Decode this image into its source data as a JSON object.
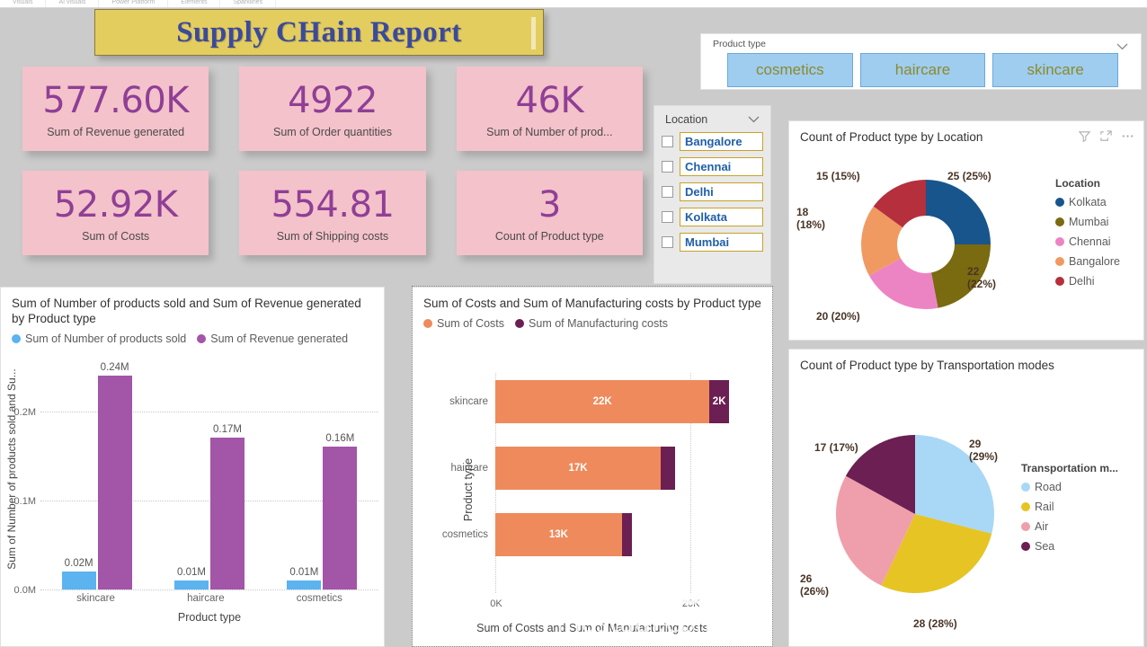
{
  "ribbon": {
    "tabs": [
      "Visuals",
      "AI visuals",
      "Power Platform",
      "Elements",
      "Sparklines"
    ]
  },
  "header": {
    "title": "Supply CHain Report",
    "banner_bg": "#e3cd5f",
    "title_color": "#3b4a9c"
  },
  "kpis": [
    {
      "value": "577.60K",
      "label": "Sum of Revenue generated"
    },
    {
      "value": "4922",
      "label": "Sum of Order quantities"
    },
    {
      "value": "46K",
      "label": "Sum of Number of prod..."
    },
    {
      "value": "52.92K",
      "label": "Sum of Costs"
    },
    {
      "value": "554.81",
      "label": "Sum of Shipping costs"
    },
    {
      "value": "3",
      "label": "Count of Product type"
    }
  ],
  "kpi_style": {
    "card_bg": "#f4c2ca",
    "value_color": "#8f3f96"
  },
  "product_type_slicer": {
    "title": "Product type",
    "caret": "chevron-down-icon",
    "options": [
      "cosmetics",
      "haircare",
      "skincare"
    ],
    "selected": [],
    "button_bg": "#9fcdf0",
    "button_text_color": "#8c8a2a"
  },
  "location_slicer": {
    "title": "Location",
    "caret": "chevron-down-icon",
    "items": [
      {
        "label": "Bangalore",
        "checked": false
      },
      {
        "label": "Chennai",
        "checked": false
      },
      {
        "label": "Delhi",
        "checked": false
      },
      {
        "label": "Kolkata",
        "checked": false
      },
      {
        "label": "Mumbai",
        "checked": false
      }
    ],
    "pill_border": "#c9a227",
    "pill_text_color": "#1f5fa8"
  },
  "visual_header_icons": [
    "filter-icon",
    "focus-mode-icon",
    "more-options-icon"
  ],
  "watermark": {
    "arabic": "مستقل",
    "latin": "mostaql.com"
  },
  "chart_data": [
    {
      "id": "column_chart",
      "type": "bar",
      "title": "Sum of Number of products sold and Sum of Revenue generated by Product type",
      "xlabel": "Product type",
      "ylabel": "Sum of Number of products sold and Su...",
      "categories": [
        "skincare",
        "haircare",
        "cosmetics"
      ],
      "ylim": [
        0,
        0.26
      ],
      "yticks": [
        "0.0M",
        "0.1M",
        "0.2M"
      ],
      "ytick_values": [
        0.0,
        0.1,
        0.2
      ],
      "grid": true,
      "legend_position": "top",
      "series": [
        {
          "name": "Sum of Number of products sold",
          "color": "#5bb3ef",
          "values": [
            0.02,
            0.01,
            0.01
          ],
          "labels": [
            "0.02M",
            "0.01M",
            "0.01M"
          ]
        },
        {
          "name": "Sum of Revenue generated",
          "color": "#a355a8",
          "values": [
            0.24,
            0.17,
            0.16
          ],
          "labels": [
            "0.24M",
            "0.17M",
            "0.16M"
          ]
        }
      ]
    },
    {
      "id": "stacked_bar_chart",
      "type": "bar",
      "orientation": "horizontal",
      "stacked": true,
      "title": "Sum of Costs and Sum of Manufacturing costs by Product type",
      "xlabel": "Sum of Costs and Sum of Manufacturing costs",
      "ylabel": "Product type",
      "categories": [
        "skincare",
        "haircare",
        "cosmetics"
      ],
      "xlim": [
        0,
        24
      ],
      "xticks": [
        "0K",
        "20K"
      ],
      "xtick_values": [
        0,
        20
      ],
      "grid": true,
      "legend_position": "top",
      "series": [
        {
          "name": "Sum of Costs",
          "color": "#ef8a5c",
          "values": [
            22,
            17,
            13
          ],
          "labels": [
            "22K",
            "17K",
            "13K"
          ]
        },
        {
          "name": "Sum of Manufacturing costs",
          "color": "#6b1f52",
          "values": [
            2,
            1.5,
            1
          ],
          "labels": [
            "2K",
            "",
            ""
          ]
        }
      ]
    },
    {
      "id": "donut_location",
      "type": "pie",
      "donut": true,
      "title": "Count of Product type by Location",
      "legend_title": "Location",
      "legend_position": "right",
      "categories": [
        "Kolkata",
        "Mumbai",
        "Chennai",
        "Bangalore",
        "Delhi"
      ],
      "values": [
        25,
        22,
        20,
        18,
        15
      ],
      "percents": [
        "25%",
        "22%",
        "20%",
        "18%",
        "15%"
      ],
      "labels": [
        "25 (25%)",
        "22\n(22%)",
        "20 (20%)",
        "18\n(18%)",
        "15 (15%)"
      ],
      "colors": [
        "#17558c",
        "#7a6a10",
        "#ec84c4",
        "#f09a62",
        "#b5303c"
      ]
    },
    {
      "id": "pie_transportation",
      "type": "pie",
      "donut": false,
      "title": "Count of Product type by Transportation modes",
      "legend_title": "Transportation m...",
      "legend_position": "right",
      "categories": [
        "Road",
        "Rail",
        "Air",
        "Sea"
      ],
      "values": [
        29,
        28,
        26,
        17
      ],
      "percents": [
        "29%",
        "28%",
        "26%",
        "17%"
      ],
      "labels": [
        "29\n(29%)",
        "28 (28%)",
        "26\n(26%)",
        "17 (17%)"
      ],
      "colors": [
        "#a8d8f5",
        "#e6c424",
        "#ef9fab",
        "#6b1f52"
      ]
    }
  ]
}
